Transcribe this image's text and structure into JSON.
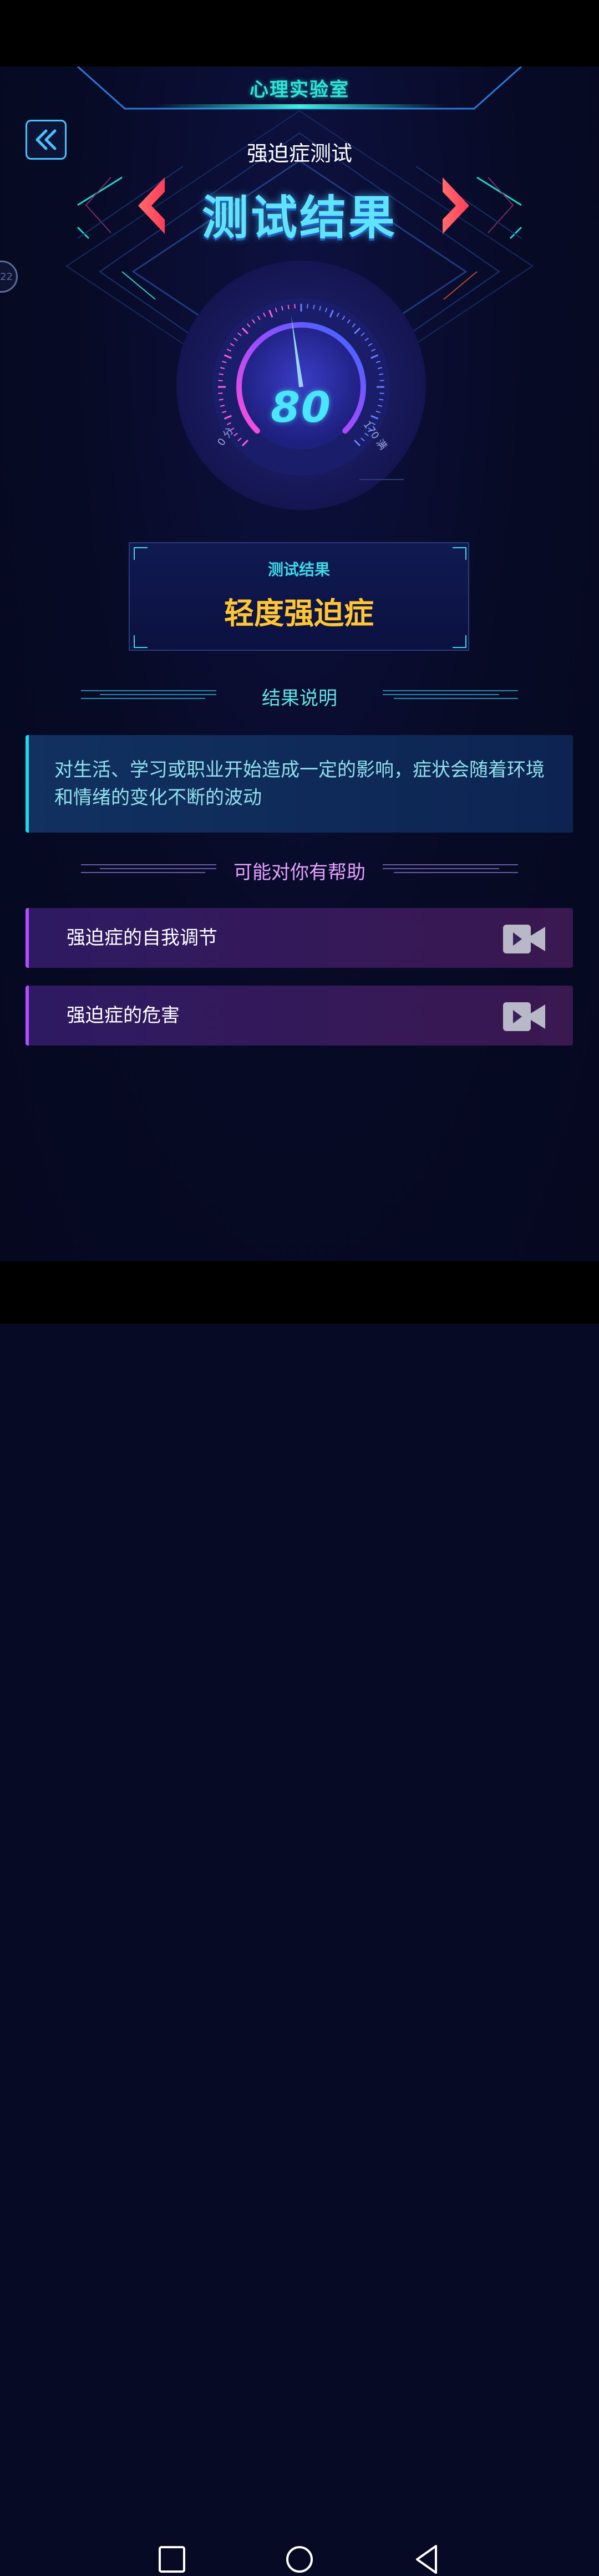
{
  "header": {
    "app_title": "心理实验室",
    "subtitle": "强迫症测试",
    "title": "测试结果"
  },
  "side_badge": "22",
  "gauge": {
    "value": "80",
    "min_label": "0 分",
    "max_label": "170 满",
    "min": 0,
    "max": 170,
    "needle_value": 80
  },
  "result": {
    "label": "测试结果",
    "value": "轻度强迫症"
  },
  "explanation": {
    "heading": "结果说明",
    "text": "对生活、学习或职业开始造成一定的影响，症状会随着环境和情绪的变化不断的波动"
  },
  "help": {
    "heading": "可能对你有帮助",
    "items": [
      {
        "label": "强迫症的自我调节",
        "icon": "video-camera-icon"
      },
      {
        "label": "强迫症的危害",
        "icon": "video-camera-icon"
      }
    ]
  },
  "colors": {
    "accent_cyan": "#2ee6d6",
    "result_yellow": "#ffc632",
    "help_purple": "#b44cff",
    "background": "#070a24"
  }
}
